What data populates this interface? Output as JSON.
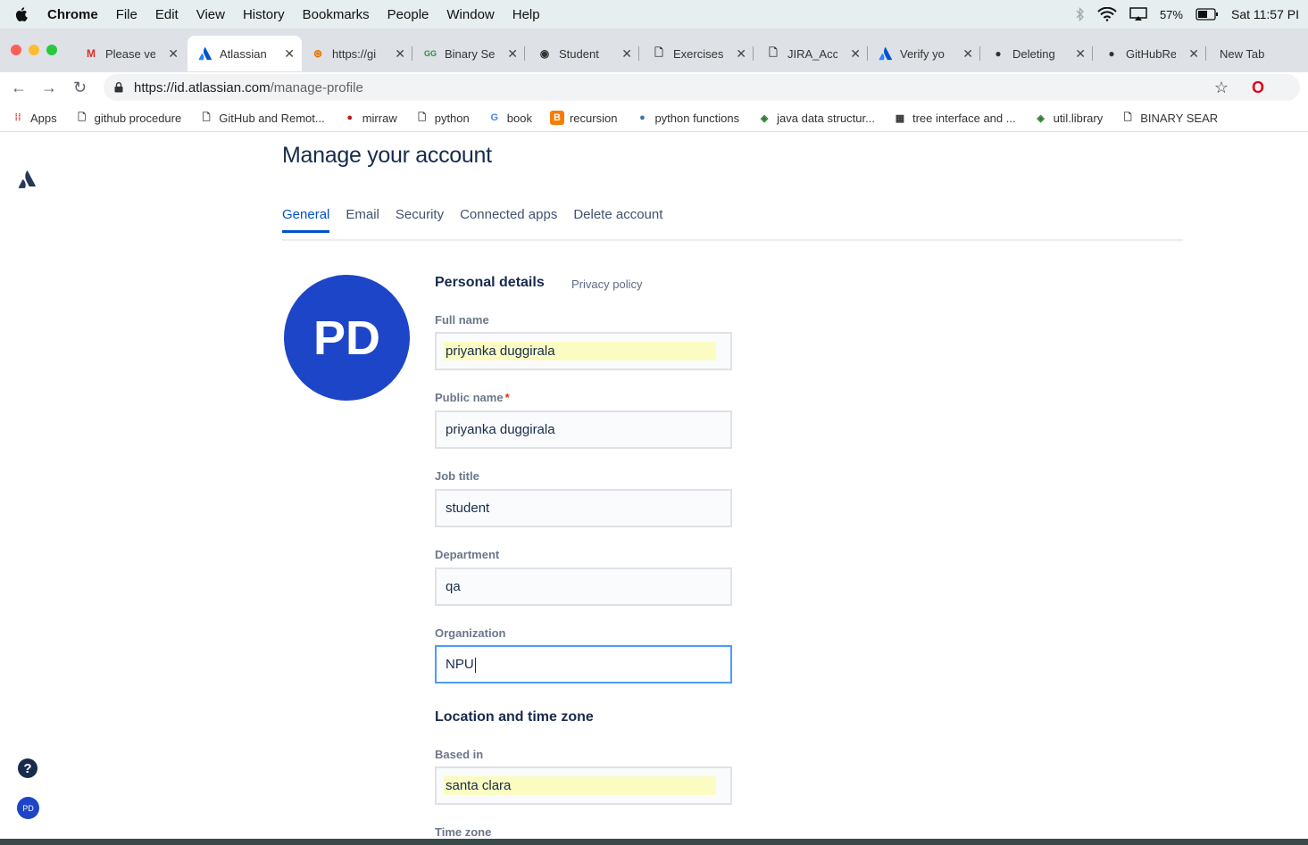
{
  "menubar": {
    "items": [
      "Chrome",
      "File",
      "Edit",
      "View",
      "History",
      "Bookmarks",
      "People",
      "Window",
      "Help"
    ],
    "battery": "57%",
    "clock": "Sat 11:57 PI"
  },
  "tabs": [
    {
      "title": "Please ve",
      "icon": "gmail-icon"
    },
    {
      "title": "Atlassian",
      "icon": "atlassian-icon"
    },
    {
      "title": "https://gi",
      "icon": "web-icon"
    },
    {
      "title": "Binary Se",
      "icon": "gfg-icon"
    },
    {
      "title": "Student",
      "icon": "web-icon"
    },
    {
      "title": "Exercises",
      "icon": "page-icon"
    },
    {
      "title": "JIRA_Acc",
      "icon": "page-icon"
    },
    {
      "title": "Verify yo",
      "icon": "atlassian-icon"
    },
    {
      "title": "Deleting",
      "icon": "github-icon"
    },
    {
      "title": "GitHubRe",
      "icon": "github-icon"
    },
    {
      "title": "New Tab",
      "icon": ""
    }
  ],
  "address": {
    "host": "https://id.atlassian.com",
    "path": "/manage-profile"
  },
  "bookmarks": [
    "Apps",
    "github procedure",
    "GitHub and Remot...",
    "mirraw",
    "python",
    "book",
    "recursion",
    "python functions",
    "java data structur...",
    "tree interface and ...",
    "util.library",
    "BINARY SEAR"
  ],
  "page": {
    "title": "Manage your account",
    "tabs": [
      "General",
      "Email",
      "Security",
      "Connected apps",
      "Delete account"
    ],
    "avatar_initials": "PD",
    "personal_details": "Personal details",
    "privacy_policy": "Privacy policy",
    "fields": {
      "full_name": {
        "label": "Full name",
        "value": "priyanka duggirala"
      },
      "public_name": {
        "label": "Public name",
        "required": "*",
        "value": "priyanka duggirala"
      },
      "job_title": {
        "label": "Job title",
        "value": "student"
      },
      "department": {
        "label": "Department",
        "value": "qa"
      },
      "organization": {
        "label": "Organization",
        "value": "NPU"
      },
      "based_in": {
        "label": "Based in",
        "value": "santa clara"
      },
      "time_zone": {
        "label": "Time zone"
      }
    },
    "location_section": "Location and time zone",
    "help_glyph": "?",
    "mini_avatar": "PD"
  }
}
